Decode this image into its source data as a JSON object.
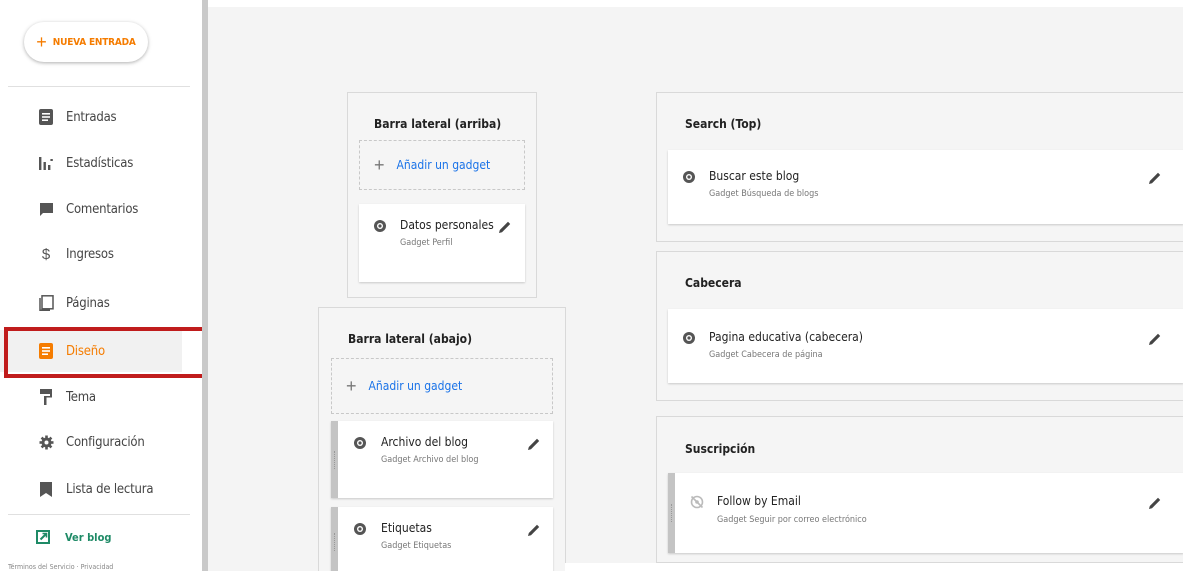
{
  "new_post": {
    "label": "NUEVA ENTRADA",
    "icon": "plus-icon"
  },
  "sidebar": {
    "items": [
      {
        "label": "Entradas",
        "icon": "posts-icon"
      },
      {
        "label": "Estadísticas",
        "icon": "stats-icon"
      },
      {
        "label": "Comentarios",
        "icon": "comment-icon"
      },
      {
        "label": "Ingresos",
        "icon": "dollar-icon"
      },
      {
        "label": "Páginas",
        "icon": "pages-icon"
      },
      {
        "label": "Diseño",
        "icon": "layout-icon",
        "active": true
      },
      {
        "label": "Tema",
        "icon": "paint-roller-icon"
      },
      {
        "label": "Configuración",
        "icon": "gear-icon"
      },
      {
        "label": "Lista de lectura",
        "icon": "bookmark-icon"
      }
    ],
    "view_blog": "Ver blog",
    "footer": "Términos del Servicio · Privacidad"
  },
  "colors": {
    "accent": "#f57c00",
    "link": "#1a73e8",
    "highlight": "#c01c1c",
    "view_blog": "#1e8a66"
  },
  "sections": {
    "sidebar_top": {
      "title": "Barra lateral (arriba)",
      "add_label": "Añadir un gadget",
      "gadgets": [
        {
          "name": "Datos personales",
          "type": "Gadget Perfil",
          "visible": true
        }
      ]
    },
    "sidebar_bottom": {
      "title": "Barra lateral (abajo)",
      "add_label": "Añadir un gadget",
      "gadgets": [
        {
          "name": "Archivo del blog",
          "type": "Gadget Archivo del blog",
          "visible": true
        },
        {
          "name": "Etiquetas",
          "type": "Gadget Etiquetas",
          "visible": true
        }
      ]
    },
    "search_top": {
      "title": "Search (Top)",
      "gadgets": [
        {
          "name": "Buscar este blog",
          "type": "Gadget Búsqueda de blogs",
          "visible": true
        }
      ]
    },
    "header": {
      "title": "Cabecera",
      "gadgets": [
        {
          "name": "Pagina educativa (cabecera)",
          "type": "Gadget Cabecera de página",
          "visible": true
        }
      ]
    },
    "subscription": {
      "title": "Suscripción",
      "gadgets": [
        {
          "name": "Follow by Email",
          "type": "Gadget Seguir por correo electrónico",
          "visible": false
        }
      ]
    }
  }
}
